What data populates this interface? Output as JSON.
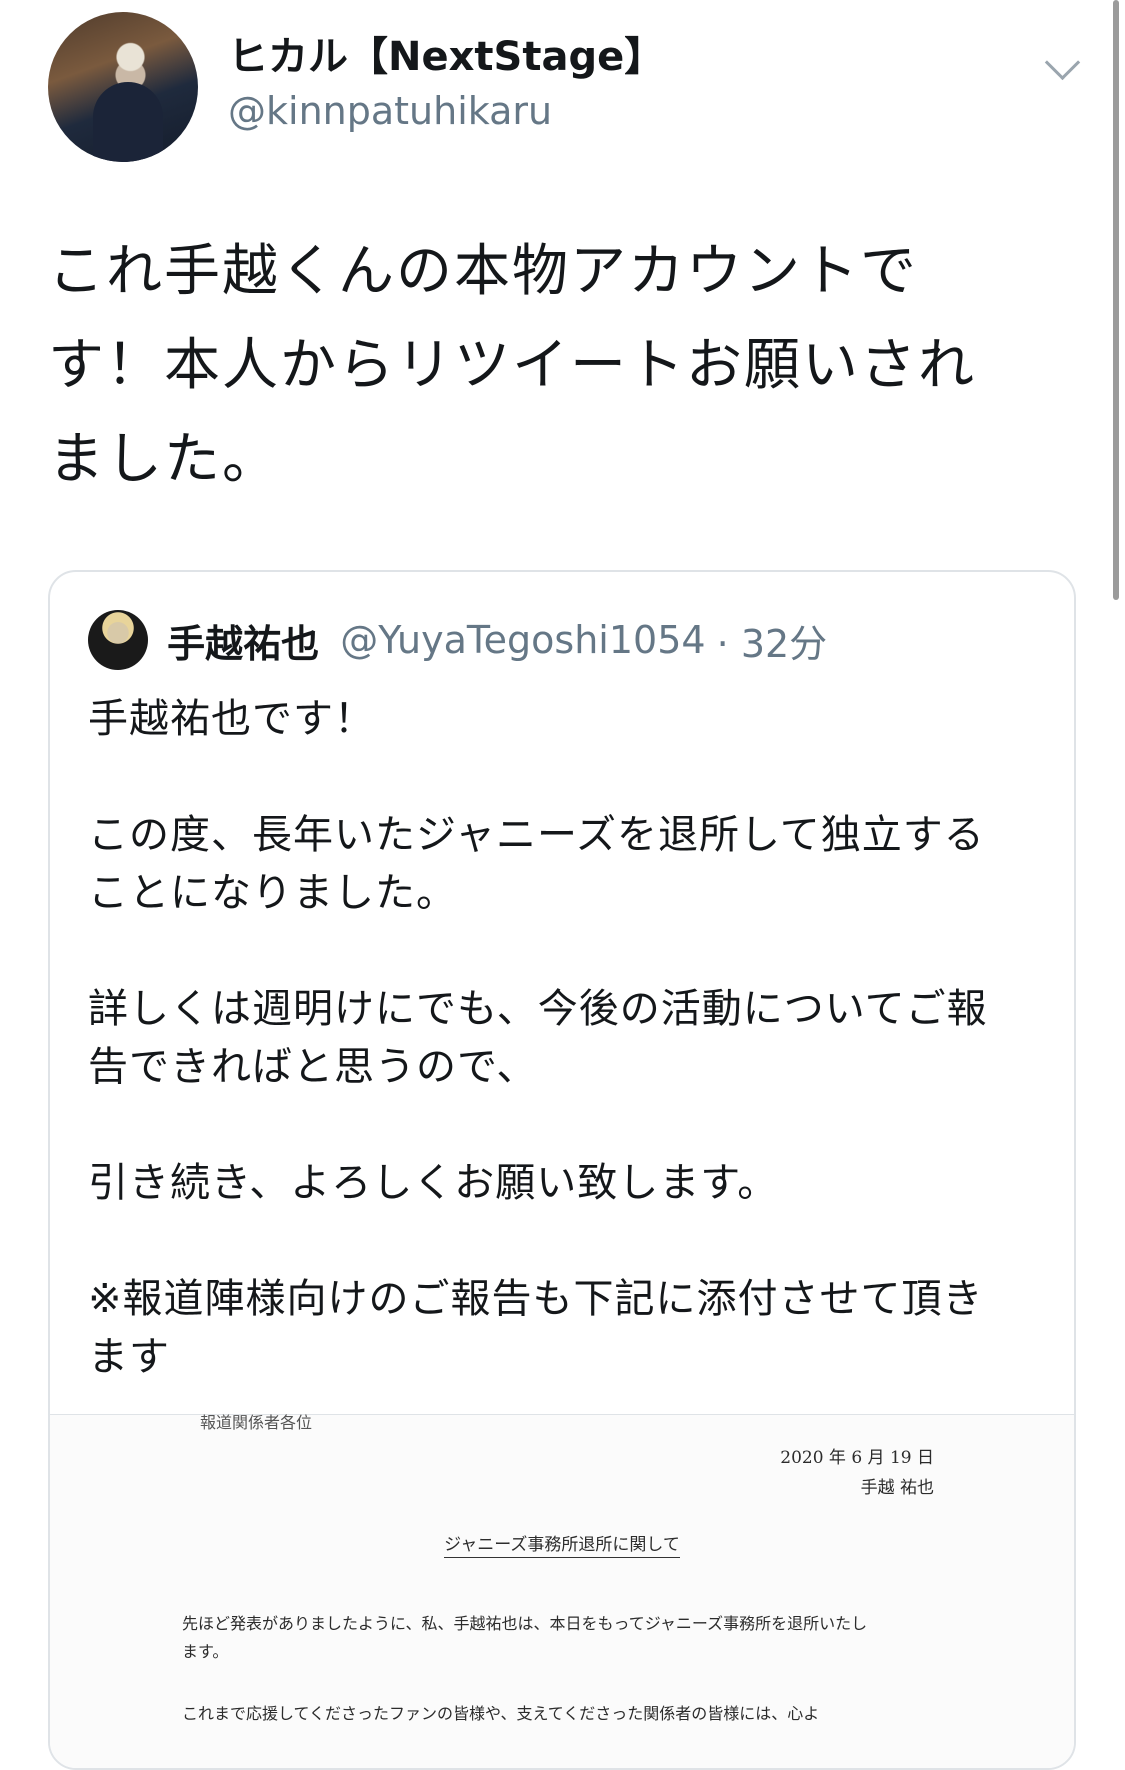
{
  "author": {
    "display_name": "ヒカル【NextStage】",
    "handle": "@kinnpatuhikaru"
  },
  "tweet": {
    "text_lines": [
      "これ手越くんの本物アカウントで",
      "す！本人からリツイートお願いされ",
      "ました。"
    ]
  },
  "quoted_tweet": {
    "display_name": "手越祐也",
    "handle": "@YuyaTegoshi1054",
    "time": "· 32分",
    "body": "手越祐也です！\n\nこの度、長年いたジャニーズを退所して独立する\nことになりました。\n\n詳しくは週明けにでも、今後の活動についてご報\n告できればと思うので、\n\n引き続き、よろしくお願い致します。\n\n※報道陣様向けのご報告も下記に添付させて頂き\nます"
  },
  "document": {
    "addressee": "報道関係者各位",
    "date": "2020 年 6 月 19 日",
    "signer": "手越 祐也",
    "title": "ジャニーズ事務所退所に関して",
    "paragraph1": "先ほど発表がありましたように、私、手越祐也は、本日をもってジャニーズ事務所を退所いたします。",
    "paragraph2": "これまで応援してくださったファンの皆様や、支えてくださった関係者の皆様には、心よ"
  },
  "icons": {
    "menu": "chevron-down-icon",
    "avatar": "avatar-image"
  }
}
